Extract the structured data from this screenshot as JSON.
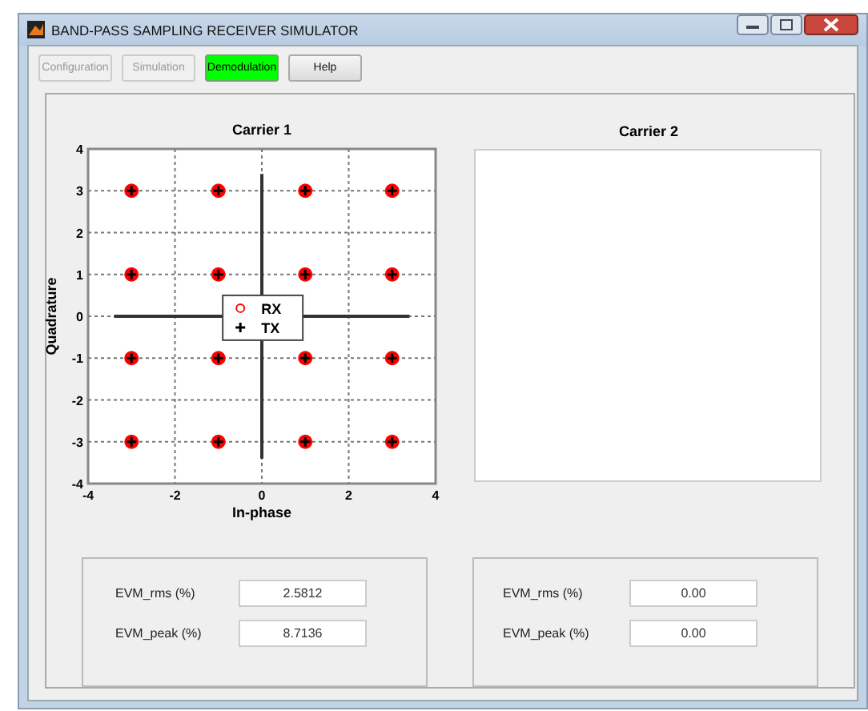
{
  "window": {
    "title": "BAND-PASS SAMPLING RECEIVER SIMULATOR"
  },
  "buttons": [
    {
      "label": "Configuration",
      "disabled": true,
      "selected": false
    },
    {
      "label": "Simulation",
      "disabled": true,
      "selected": false
    },
    {
      "label": "Demodulation",
      "disabled": false,
      "selected": true
    },
    {
      "label": "Help",
      "disabled": false,
      "selected": false
    }
  ],
  "carriers": [
    {
      "title": "Carrier 1",
      "chart_data": {
        "type": "scatter",
        "xlabel": "In-phase",
        "ylabel": "Quadrature",
        "xlim": [
          -4,
          4
        ],
        "ylim": [
          -4,
          4
        ],
        "xticks": [
          -4,
          -2,
          0,
          2,
          4
        ],
        "yticks": [
          -4,
          -3,
          -2,
          -1,
          0,
          1,
          2,
          3,
          4
        ],
        "grid": true,
        "legend": true,
        "x": [
          -3,
          -1,
          1,
          3,
          -3,
          -1,
          1,
          3,
          -3,
          -1,
          1,
          3,
          -3,
          -1,
          1,
          3
        ],
        "series": [
          {
            "name": "RX",
            "color": "#ff0000",
            "values": [
              3,
              3,
              3,
              3,
              1,
              1,
              1,
              1,
              -1,
              -1,
              -1,
              -1,
              -3,
              -3,
              -3,
              -3
            ]
          },
          {
            "name": "TX",
            "color": "#000000",
            "values": [
              3,
              3,
              3,
              3,
              1,
              1,
              1,
              1,
              -1,
              -1,
              -1,
              -1,
              -3,
              -3,
              -3,
              -3
            ]
          }
        ]
      },
      "evm_rms_label": "EVM_rms (%)",
      "evm_rms": "2.5812",
      "evm_peak_label": "EVM_peak (%)",
      "evm_peak": "8.7136"
    },
    {
      "title": "Carrier 2",
      "evm_rms_label": "EVM_rms (%)",
      "evm_rms": "0.00",
      "evm_peak_label": "EVM_peak (%)",
      "evm_peak": "0.00"
    }
  ]
}
